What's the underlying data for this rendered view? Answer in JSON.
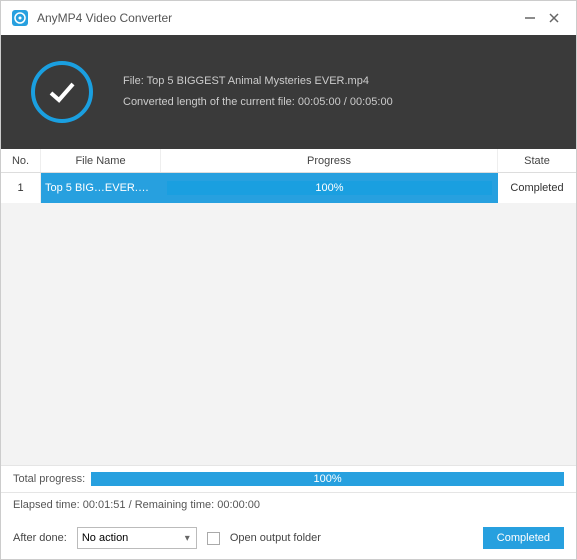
{
  "app": {
    "title": "AnyMP4 Video Converter"
  },
  "statusPanel": {
    "fileLabel": "File: Top 5 BIGGEST Animal Mysteries EVER.mp4",
    "convertedLabel": "Converted length of the current file: 00:05:00 / 00:05:00"
  },
  "table": {
    "headers": {
      "no": "No.",
      "fileName": "File Name",
      "progress": "Progress",
      "state": "State"
    },
    "rows": [
      {
        "no": "1",
        "fileName": "Top 5 BIG…EVER.mp4",
        "progressText": "100%",
        "state": "Completed"
      }
    ]
  },
  "totalProgress": {
    "label": "Total progress:",
    "text": "100%"
  },
  "timeInfo": "Elapsed time: 00:01:51 / Remaining time: 00:00:00",
  "afterDone": {
    "label": "After done:",
    "select": "No action",
    "checkboxLabel": "Open output folder"
  },
  "completedButton": "Completed"
}
